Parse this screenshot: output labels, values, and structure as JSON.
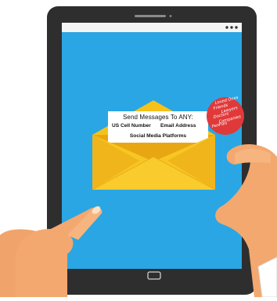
{
  "envelope_letter": {
    "heading": "Send Messages To ANY:",
    "left_option": "US Cell Number",
    "right_option": "Email Address",
    "bottom_option": "Social Media Platforms"
  },
  "badge": {
    "lines": [
      "Loved Ones",
      "Friends",
      "Lawyers",
      "Doctors",
      "Companies",
      "PenPals"
    ]
  },
  "colors": {
    "screen": "#2aa6e4",
    "tablet": "#2e2e2e",
    "envelope": "#f6c21a",
    "badge": "#e0393a"
  }
}
